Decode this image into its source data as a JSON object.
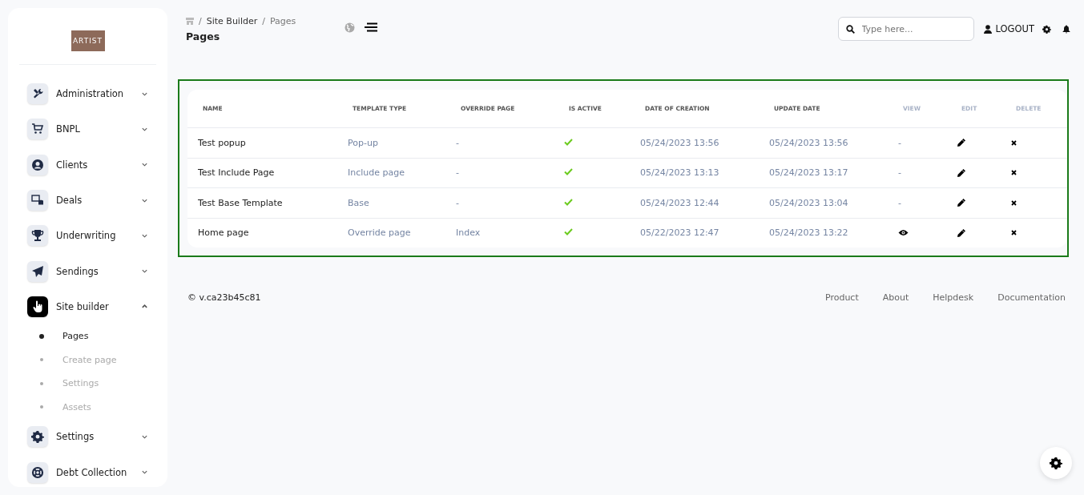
{
  "logo": {
    "text": "ARTIST"
  },
  "sidebar": {
    "items": [
      {
        "label": "Administration",
        "expanded": false,
        "selected": false
      },
      {
        "label": "BNPL",
        "expanded": false,
        "selected": false
      },
      {
        "label": "Clients",
        "expanded": false,
        "selected": false
      },
      {
        "label": "Deals",
        "expanded": false,
        "selected": false
      },
      {
        "label": "Underwriting",
        "expanded": false,
        "selected": false
      },
      {
        "label": "Sendings",
        "expanded": false,
        "selected": false
      },
      {
        "label": "Site builder",
        "expanded": true,
        "selected": true,
        "children": [
          {
            "label": "Pages",
            "selected": true
          },
          {
            "label": "Create page",
            "selected": false
          },
          {
            "label": "Settings",
            "selected": false
          },
          {
            "label": "Assets",
            "selected": false
          }
        ]
      },
      {
        "label": "Settings",
        "expanded": false,
        "selected": false
      },
      {
        "label": "Debt Collection",
        "expanded": false,
        "selected": false
      }
    ]
  },
  "breadcrumb": {
    "separator": "/",
    "items": [
      "Site Builder",
      "Pages"
    ]
  },
  "page_title": "Pages",
  "search": {
    "placeholder": "Type here..."
  },
  "logout": "LOGOUT",
  "table": {
    "columns": [
      "NAME",
      "TEMPLATE TYPE",
      "OVERRIDE PAGE",
      "IS ACTIVE",
      "DATE OF CREATION",
      "UPDATE DATE",
      "VIEW",
      "EDIT",
      "DELETE"
    ],
    "rows": [
      {
        "name": "Test popup",
        "template_type": "Pop-up",
        "override_page": "-",
        "is_active": true,
        "created": "05/24/2023 13:56",
        "updated": "05/24/2023 13:56",
        "view": {
          "kind": "text",
          "text": "-"
        }
      },
      {
        "name": "Test Include Page",
        "template_type": "Include page",
        "override_page": "-",
        "is_active": true,
        "created": "05/24/2023 13:13",
        "updated": "05/24/2023 13:17",
        "view": {
          "kind": "text",
          "text": "-"
        }
      },
      {
        "name": "Test Base Template",
        "template_type": "Base",
        "override_page": "-",
        "is_active": true,
        "created": "05/24/2023 12:44",
        "updated": "05/24/2023 13:04",
        "view": {
          "kind": "text",
          "text": "-"
        }
      },
      {
        "name": "Home page",
        "template_type": "Override page",
        "override_page": "Index",
        "is_active": true,
        "created": "05/22/2023 12:47",
        "updated": "05/24/2023 13:22",
        "view": {
          "kind": "eye"
        }
      }
    ]
  },
  "footer": {
    "version": "© v.ca23b45c81",
    "links": [
      "Product",
      "About",
      "Helpdesk",
      "Documentation"
    ]
  }
}
